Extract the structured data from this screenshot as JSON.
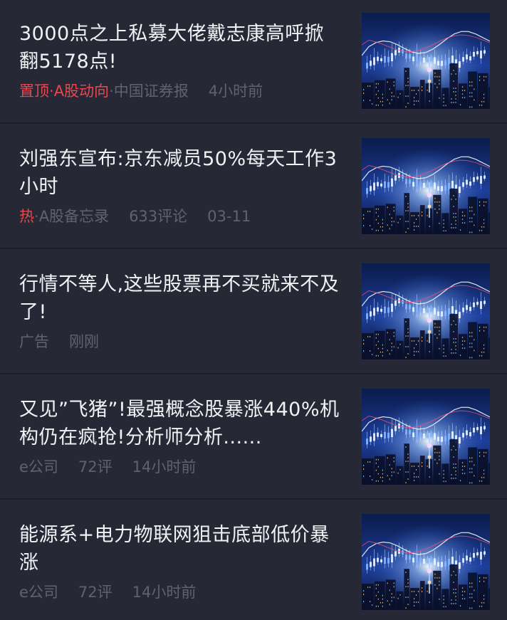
{
  "feed": {
    "items": [
      {
        "title": "3000点之上私募大佬戴志康高呼掀翻5178点!",
        "tag": "置顶",
        "tag_sep": "·",
        "tag2": "A股动向",
        "source_sep": "·",
        "source": "中国证券报",
        "time": "4小时前",
        "thumbnail": "stock-city-thumbnail"
      },
      {
        "title": "刘强东宣布:京东减员50%每天工作3小时",
        "tag": "热",
        "source_sep": "·",
        "source": "A股备忘录",
        "comments": "633评论",
        "time": "03-11",
        "thumbnail": "stock-city-thumbnail"
      },
      {
        "title": "行情不等人,这些股票再不买就来不及了!",
        "source": "广告",
        "time": "刚刚",
        "thumbnail": "stock-city-thumbnail"
      },
      {
        "title": "又见”飞猪”!最强概念股暴涨440%机构仍在疯抢!分析师分析......",
        "source": "e公司",
        "comments": "72评",
        "time": "14小时前",
        "thumbnail": "stock-city-thumbnail"
      },
      {
        "title": "能源系+电力物联网狙击底部低价暴涨",
        "source": "e公司",
        "comments": "72评",
        "time": "14小时前",
        "thumbnail": "stock-city-thumbnail"
      }
    ]
  },
  "colors": {
    "background": "#262836",
    "title_text": "#f2f2f5",
    "meta_text": "#5f6270",
    "highlight_red": "#e8484d"
  }
}
